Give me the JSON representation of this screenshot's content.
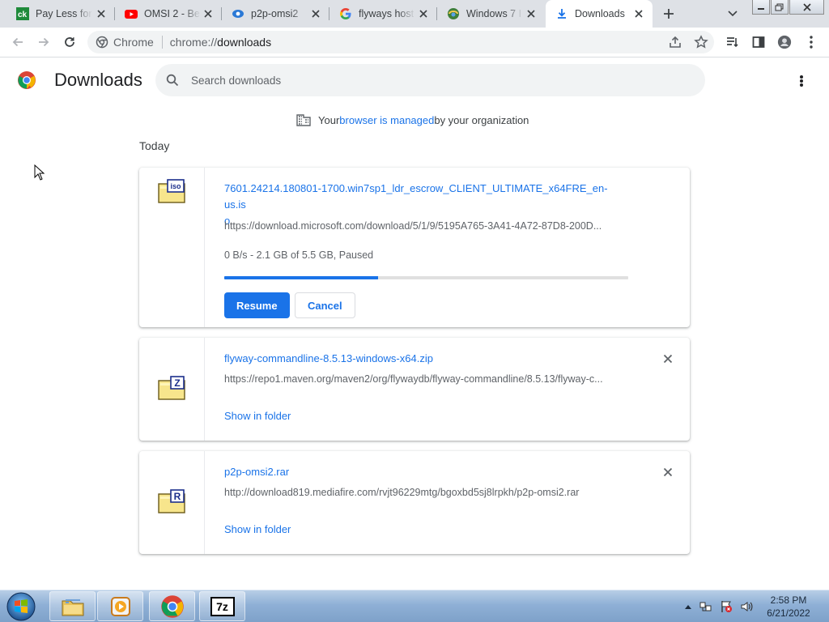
{
  "tabs": [
    {
      "title": "Pay Less for",
      "favicon": "ck-favicon",
      "active": false
    },
    {
      "title": "OMSI 2 - Be",
      "favicon": "youtube-favicon",
      "active": false
    },
    {
      "title": "p2p-omsi2",
      "favicon": "p2p-favicon",
      "active": false
    },
    {
      "title": "flyways host",
      "favicon": "google-favicon",
      "active": false
    },
    {
      "title": "Windows 7 I",
      "favicon": "windows-favicon",
      "active": false
    },
    {
      "title": "Downloads",
      "favicon": "download-favicon",
      "active": true
    }
  ],
  "omnibox": {
    "chip": "Chrome",
    "scheme": "chrome://",
    "path": "downloads"
  },
  "header": {
    "title": "Downloads",
    "search_placeholder": "Search downloads"
  },
  "managed_notice": {
    "prefix": "Your ",
    "link": "browser is managed",
    "suffix": " by your organization"
  },
  "section_label": "Today",
  "downloads": [
    {
      "filename": "7601.24214.180801-1700.win7sp1_ldr_escrow_CLIENT_ULTIMATE_x64FRE_en-us.iso",
      "filename_line1": "7601.24214.180801-1700.win7sp1_ldr_escrow_CLIENT_ULTIMATE_x64FRE_en-us.is",
      "filename_line2": "o",
      "url": "https://download.microsoft.com/download/5/1/9/5195A765-3A41-4A72-87D8-200D...",
      "status": "0 B/s - 2.1 GB of 5.5 GB, Paused",
      "progress_fraction": 0.38,
      "icon_letter": "iso",
      "resume_label": "Resume",
      "cancel_label": "Cancel"
    },
    {
      "filename": "flyway-commandline-8.5.13-windows-x64.zip",
      "url": "https://repo1.maven.org/maven2/org/flywaydb/flyway-commandline/8.5.13/flyway-c...",
      "icon_letter": "Z",
      "action_label": "Show in folder"
    },
    {
      "filename": "p2p-omsi2.rar",
      "url": "http://download819.mediafire.com/rvjt96229mtg/bgoxbd5sj8lrpkh/p2p-omsi2.rar",
      "icon_letter": "R",
      "action_label": "Show in folder"
    }
  ],
  "taskbar": {
    "apps": [
      "windows-explorer-icon",
      "media-player-icon",
      "chrome-icon",
      "7zip-icon"
    ],
    "sevenzip_label": "7z",
    "clock_time": "2:58 PM",
    "clock_date": "6/21/2022"
  },
  "colors": {
    "accent": "#1a73e8",
    "tabstrip": "#dee1e6",
    "progress_track": "#e0e0e0"
  }
}
